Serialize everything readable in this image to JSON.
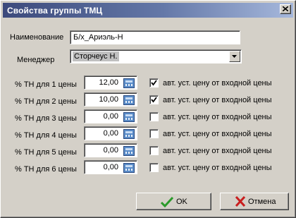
{
  "window": {
    "title": "Свойства группы ТМЦ"
  },
  "form": {
    "name_label": "Наименование",
    "name_value": "Б/х_Ариэль-Н",
    "manager_label": "Менеджер",
    "manager_value": "Сторчеус Н."
  },
  "prices": [
    {
      "label": "% ТН для 1 цены",
      "value": "12,00",
      "auto_label": "авт. уст. цену от входной цены",
      "checked": true
    },
    {
      "label": "% ТН для 2 цены",
      "value": "10,00",
      "auto_label": "авт. уст. цену от входной цены",
      "checked": true
    },
    {
      "label": "% ТН для 3 цены",
      "value": "0,00",
      "auto_label": "авт. уст. цену от входной цены",
      "checked": false
    },
    {
      "label": "% ТН для 4 цены",
      "value": "0,00",
      "auto_label": "авт. уст. цену от входной цены",
      "checked": false
    },
    {
      "label": "% ТН для 5 цены",
      "value": "0,00",
      "auto_label": "авт. уст. цену от входной цены",
      "checked": false
    },
    {
      "label": "% ТН для 6 цены",
      "value": "0,00",
      "auto_label": "авт. уст. цену от входной цены",
      "checked": false
    }
  ],
  "buttons": {
    "ok": "OK",
    "cancel": "Отмена"
  },
  "icons": {
    "close": "close-icon",
    "dropdown": "chevron-down-icon",
    "calculator": "calculator-icon",
    "checkmark": "checkmark-icon",
    "ok": "green-check-icon",
    "cancel": "red-x-icon"
  },
  "colors": {
    "title_start": "#3c4a7c",
    "title_end": "#a6b8dc",
    "ok_icon": "#2a9a2a",
    "cancel_icon": "#c81e1e"
  }
}
